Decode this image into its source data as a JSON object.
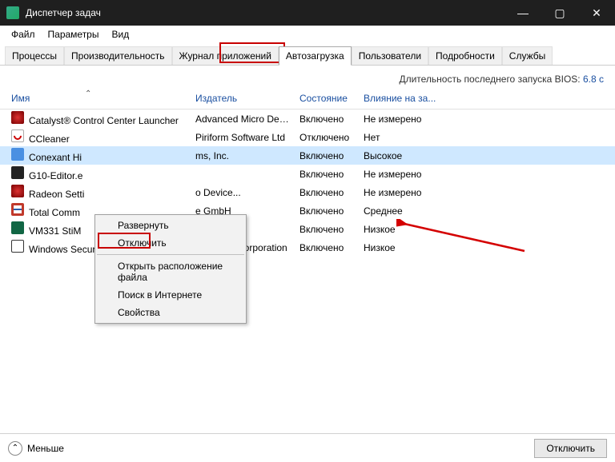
{
  "window": {
    "title": "Диспетчер задач"
  },
  "menubar": [
    "Файл",
    "Параметры",
    "Вид"
  ],
  "tabs": [
    "Процессы",
    "Производительность",
    "Журнал приложений",
    "Автозагрузка",
    "Пользователи",
    "Подробности",
    "Службы"
  ],
  "active_tab_index": 3,
  "bios": {
    "label": "Длительность последнего запуска BIOS:",
    "value": "6.8 с"
  },
  "columns": {
    "name": "Имя",
    "publisher": "Издатель",
    "state": "Состояние",
    "impact": "Влияние на за..."
  },
  "rows": [
    {
      "icon": "ic-cat",
      "name": "Catalyst® Control Center Launcher",
      "publisher": "Advanced Micro Device...",
      "state": "Включено",
      "impact": "Не измерено"
    },
    {
      "icon": "ic-cc",
      "name": "CCleaner",
      "publisher": "Piriform Software Ltd",
      "state": "Отключено",
      "impact": "Нет"
    },
    {
      "icon": "ic-cx",
      "name": "Conexant Hi",
      "publisher": "ms, Inc.",
      "state": "Включено",
      "impact": "Высокое",
      "selected": true
    },
    {
      "icon": "ic-g10",
      "name": "G10-Editor.e",
      "publisher": "",
      "state": "Включено",
      "impact": "Не измерено"
    },
    {
      "icon": "ic-rad",
      "name": "Radeon Setti",
      "publisher": "o Device...",
      "state": "Включено",
      "impact": "Не измерено"
    },
    {
      "icon": "ic-tc",
      "name": "Total Comm",
      "publisher": "e GmbH",
      "state": "Включено",
      "impact": "Среднее"
    },
    {
      "icon": "ic-vm",
      "name": "VM331 StiM",
      "publisher": "",
      "state": "Включено",
      "impact": "Низкое"
    },
    {
      "icon": "ic-sec",
      "name": "Windows Security notification icon",
      "publisher": "Microsoft Corporation",
      "state": "Включено",
      "impact": "Низкое"
    }
  ],
  "context_menu": {
    "items_top": [
      "Развернуть",
      "Отключить"
    ],
    "items_bottom": [
      "Открыть расположение файла",
      "Поиск в Интернете",
      "Свойства"
    ]
  },
  "footer": {
    "fewer": "Меньше",
    "disable": "Отключить"
  }
}
